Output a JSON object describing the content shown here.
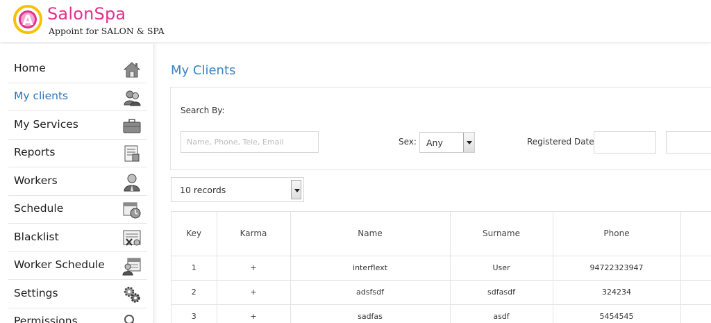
{
  "brand": {
    "name": "SalonSpa",
    "tagline": "Appoint for SALON & SPA",
    "logo_letter": "A",
    "colors": {
      "pink": "#e62f8c",
      "yellow": "#f6c200",
      "link_blue": "#3a84c3"
    }
  },
  "sidebar": {
    "items": [
      {
        "label": "Home",
        "icon": "house-icon",
        "active": false
      },
      {
        "label": "My clients",
        "icon": "users-icon",
        "active": true
      },
      {
        "label": "My Services",
        "icon": "briefcase-icon",
        "active": false
      },
      {
        "label": "Reports",
        "icon": "report-icon",
        "active": false
      },
      {
        "label": "Workers",
        "icon": "worker-icon",
        "active": false
      },
      {
        "label": "Schedule",
        "icon": "calendar-clock-icon",
        "active": false
      },
      {
        "label": "Blacklist",
        "icon": "blacklist-icon",
        "active": false
      },
      {
        "label": "Worker Schedule",
        "icon": "worker-calendar-icon",
        "active": false
      },
      {
        "label": "Settings",
        "icon": "gears-icon",
        "active": false
      },
      {
        "label": "Permissions",
        "icon": "key-icon",
        "active": false
      }
    ]
  },
  "main": {
    "title": "My Clients",
    "filters": {
      "search_by_label": "Search By:",
      "search_placeholder": "Name, Phone, Tele, Email",
      "sex_label": "Sex:",
      "sex_value": "Any",
      "registered_label": "Registered Date:"
    },
    "records_per_page": "10 records",
    "table": {
      "columns": [
        "Key",
        "Karma",
        "Name",
        "Surname",
        "Phone"
      ],
      "rows": [
        [
          "1",
          "+",
          "interflext",
          "User",
          "94722323947"
        ],
        [
          "2",
          "+",
          "adsfsdf",
          "sdfasdf",
          "324234"
        ],
        [
          "3",
          "+",
          "sadfas",
          "asdf",
          "5454545"
        ]
      ]
    }
  }
}
